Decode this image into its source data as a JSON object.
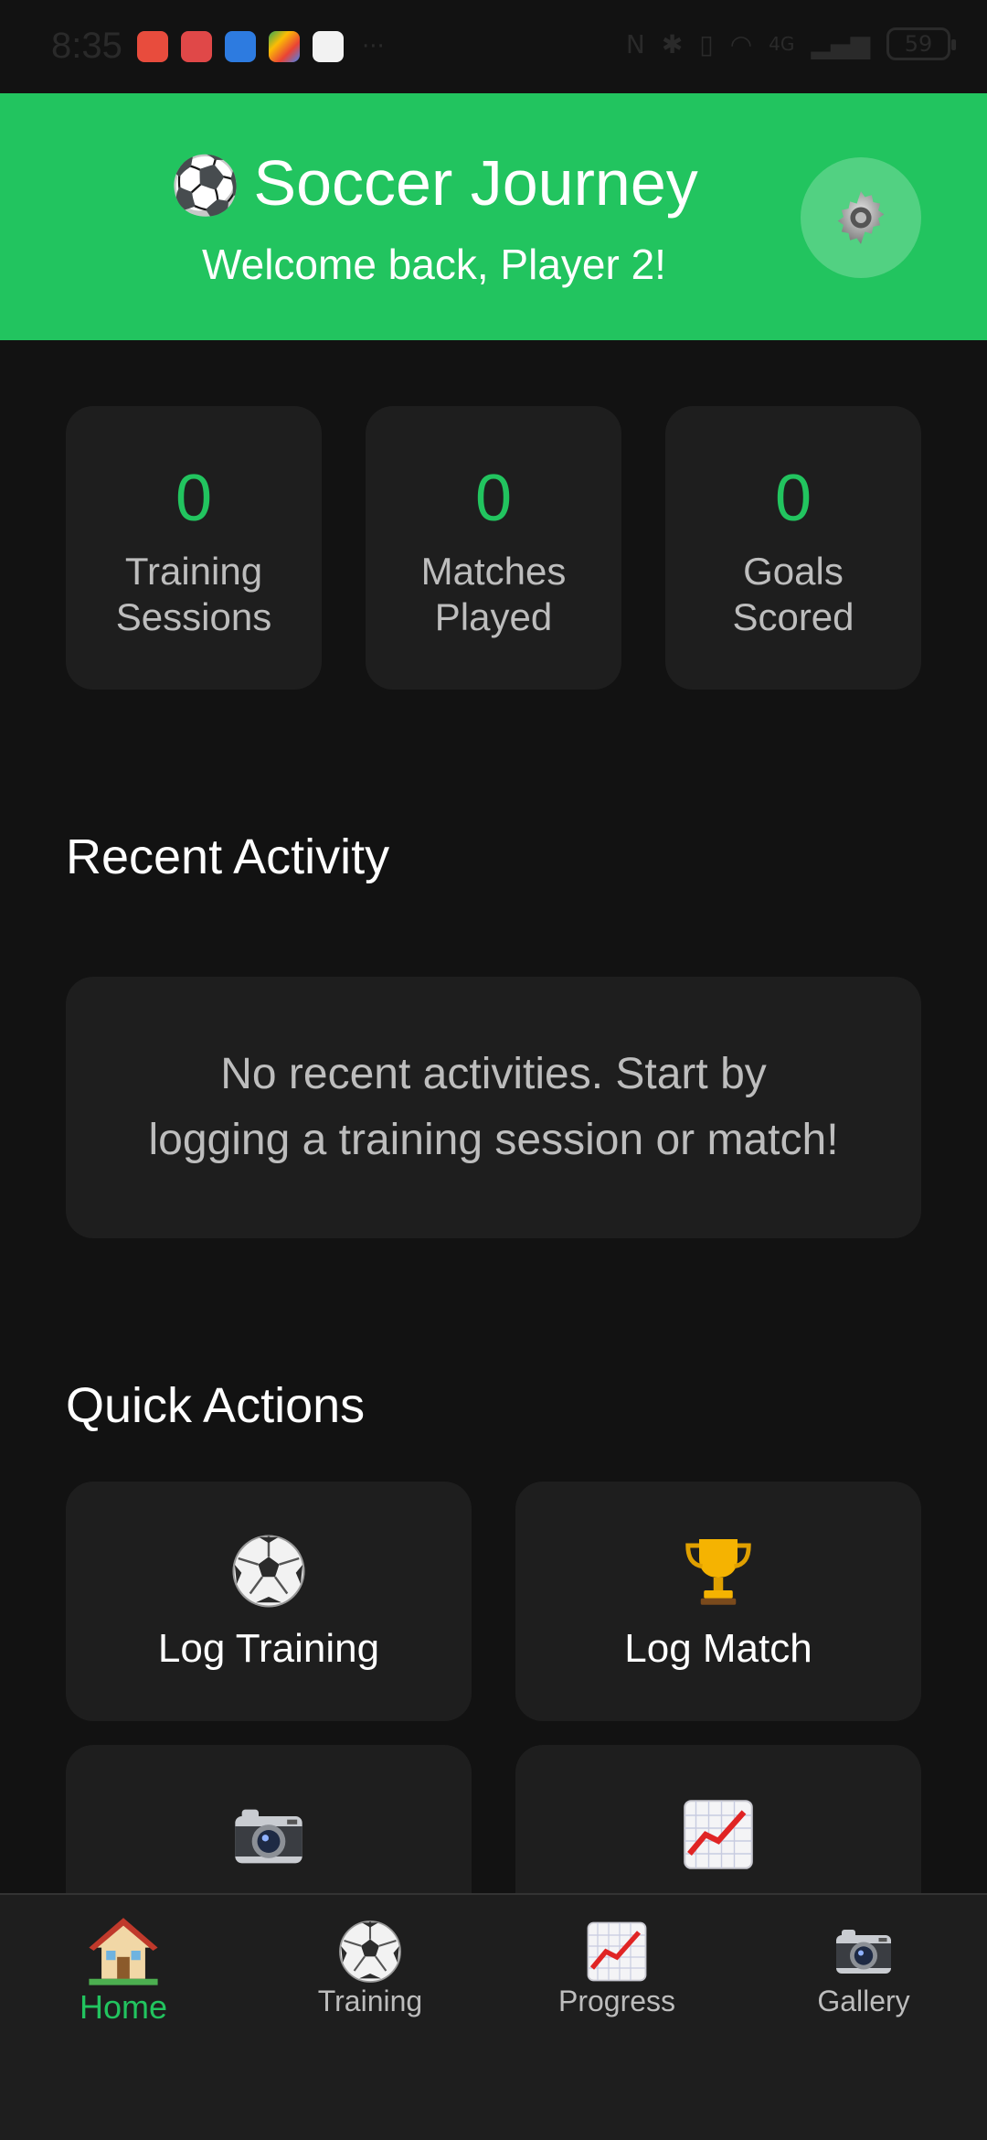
{
  "status_bar": {
    "time": "8:35",
    "more": "···",
    "network": "4G",
    "battery": "59"
  },
  "header": {
    "title": "Soccer Journey",
    "welcome": "Welcome back, Player 2!"
  },
  "stats": [
    {
      "value": "0",
      "label_line1": "Training",
      "label_line2": "Sessions"
    },
    {
      "value": "0",
      "label_line1": "Matches",
      "label_line2": "Played"
    },
    {
      "value": "0",
      "label_line1": "Goals",
      "label_line2": "Scored"
    }
  ],
  "recent_activity": {
    "title": "Recent Activity",
    "empty_line1": "No recent activities. Start by",
    "empty_line2": "logging a training session or match!"
  },
  "quick_actions": {
    "title": "Quick Actions",
    "items": [
      {
        "label": "Log Training",
        "icon": "soccer-ball-icon"
      },
      {
        "label": "Log Match",
        "icon": "trophy-icon"
      },
      {
        "label": "",
        "icon": "camera-icon"
      },
      {
        "label": "",
        "icon": "chart-icon"
      }
    ]
  },
  "bottom_nav": [
    {
      "label": "Home",
      "icon": "house-icon",
      "active": true
    },
    {
      "label": "Training",
      "icon": "soccer-ball-icon",
      "active": false
    },
    {
      "label": "Progress",
      "icon": "chart-icon",
      "active": false
    },
    {
      "label": "Gallery",
      "icon": "camera-icon",
      "active": false
    }
  ],
  "colors": {
    "accent": "#22c45f",
    "background": "#121212",
    "card": "#1e1e1e",
    "muted_text": "#bdbdbd"
  }
}
